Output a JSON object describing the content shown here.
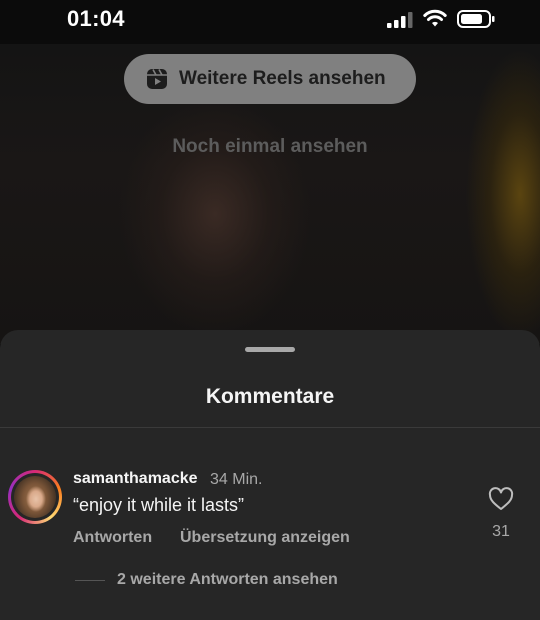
{
  "status_bar": {
    "time": "01:04"
  },
  "video": {
    "more_reels_label": "Weitere Reels ansehen",
    "watch_again_label": "Noch einmal ansehen"
  },
  "comments_sheet": {
    "title": "Kommentare",
    "comments": [
      {
        "username": "samanthamacke",
        "timestamp": "34 Min.",
        "text": "“enjoy it while it lasts”",
        "reply_label": "Antworten",
        "translate_label": "Übersetzung anzeigen",
        "like_count": "31",
        "view_replies_label": "2 weitere Antworten ansehen"
      }
    ]
  },
  "icons": {
    "signal": "cellular-signal-icon",
    "wifi": "wifi-icon",
    "battery": "battery-icon",
    "reels": "reels-icon",
    "like": "heart-icon"
  },
  "colors": {
    "sheet_background": "#262626",
    "secondary_text": "#a8a8a8",
    "story_ring": "#d62976"
  }
}
